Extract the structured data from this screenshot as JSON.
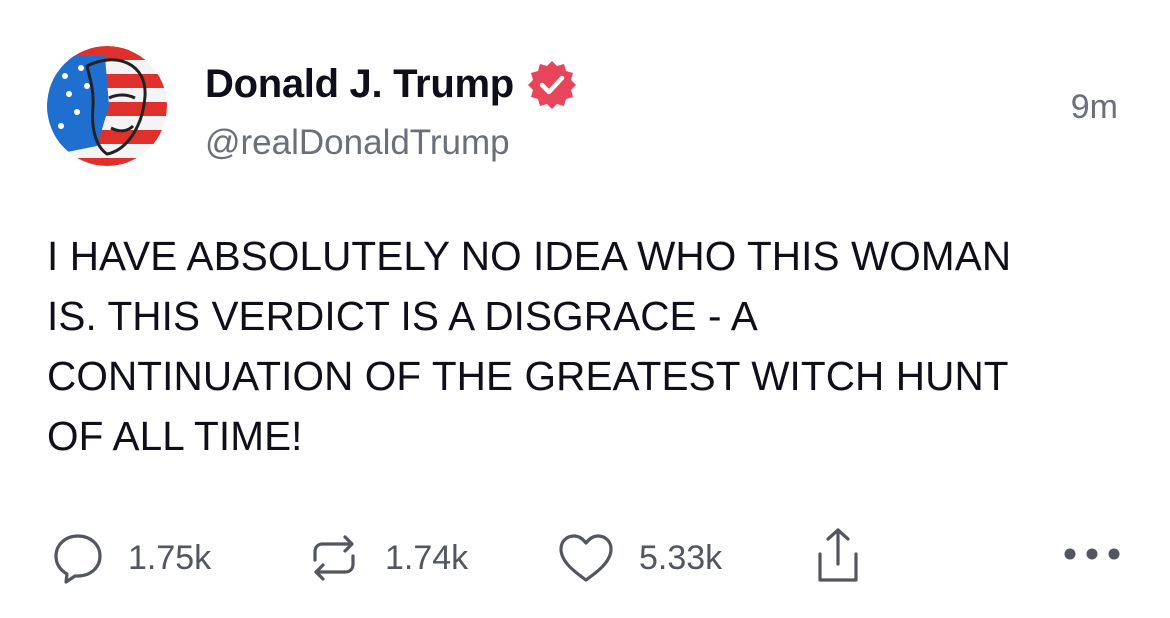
{
  "post": {
    "author": {
      "display_name": "Donald J. Trump",
      "handle": "@realDonaldTrump",
      "verified_icon": "verified-badge-icon",
      "verified_color": "#e8445a"
    },
    "timestamp": "9m",
    "body_lines": [
      "I HAVE ABSOLUTELY NO IDEA WHO THIS WOMAN",
      "IS. THIS VERDICT IS A DISGRACE - A",
      "CONTINUATION OF THE GREATEST WITCH HUNT",
      "OF ALL TIME!"
    ],
    "actions": {
      "reply": {
        "icon": "reply-icon",
        "count": "1.75k"
      },
      "repost": {
        "icon": "repost-icon",
        "count": "1.74k"
      },
      "like": {
        "icon": "heart-icon",
        "count": "5.33k"
      },
      "share": {
        "icon": "share-icon"
      },
      "more": {
        "icon": "more-dots-icon"
      }
    }
  }
}
